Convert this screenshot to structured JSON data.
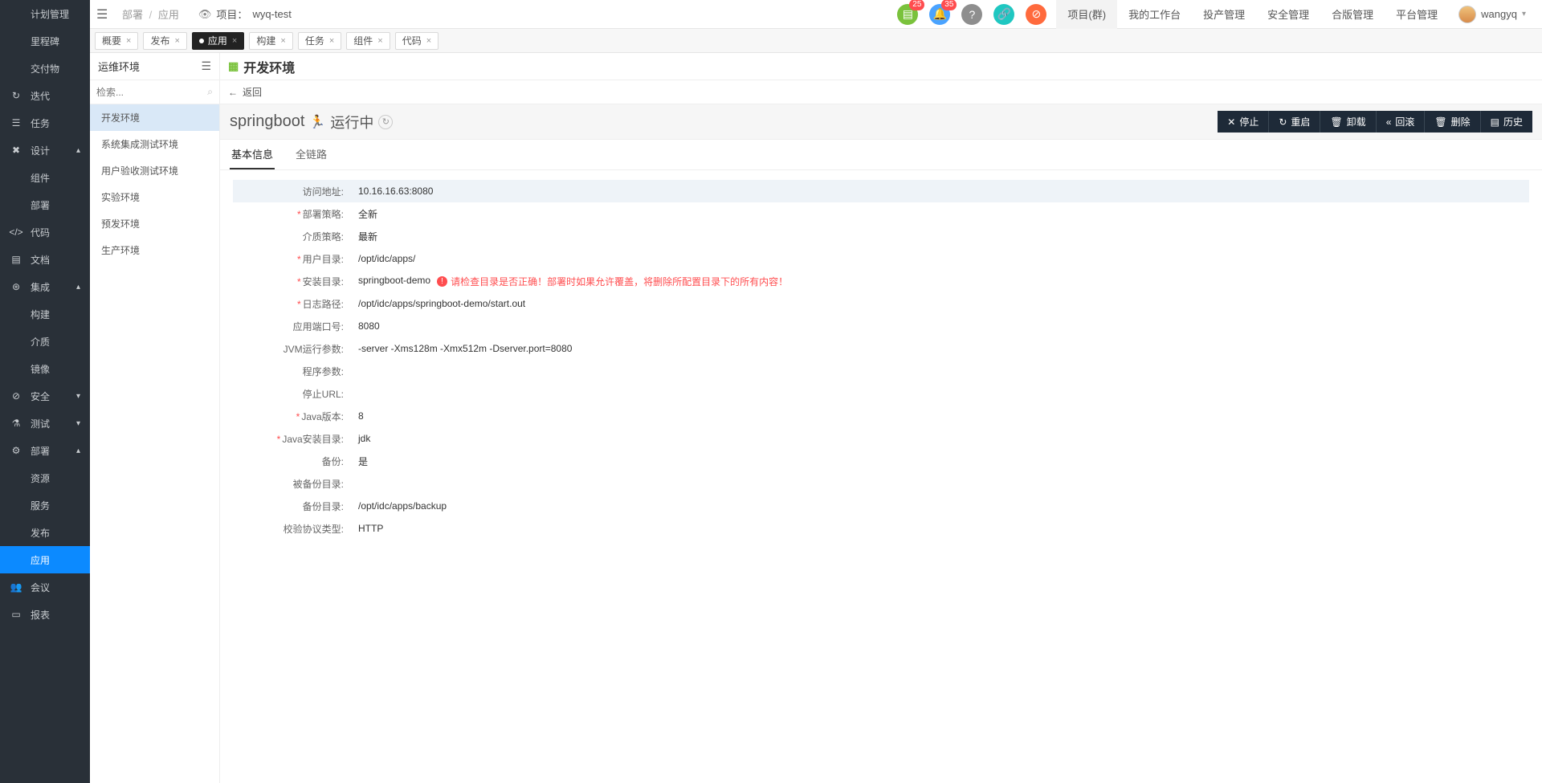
{
  "nav": {
    "items": [
      {
        "label": "计划管理",
        "icon": "",
        "sub": false,
        "head": true
      },
      {
        "label": "里程碑",
        "icon": "",
        "sub": true
      },
      {
        "label": "交付物",
        "icon": "",
        "sub": true
      },
      {
        "label": "迭代",
        "icon": "↻",
        "sub": false
      },
      {
        "label": "任务",
        "icon": "☰",
        "sub": false
      },
      {
        "label": "设计",
        "icon": "✖",
        "sub": false,
        "chev": "▴"
      },
      {
        "label": "组件",
        "icon": "",
        "sub": true
      },
      {
        "label": "部署",
        "icon": "",
        "sub": true
      },
      {
        "label": "代码",
        "icon": "</>",
        "sub": false
      },
      {
        "label": "文档",
        "icon": "▤",
        "sub": false
      },
      {
        "label": "集成",
        "icon": "⊛",
        "sub": false,
        "chev": "▴"
      },
      {
        "label": "构建",
        "icon": "",
        "sub": true
      },
      {
        "label": "介质",
        "icon": "",
        "sub": true
      },
      {
        "label": "镜像",
        "icon": "",
        "sub": true
      },
      {
        "label": "安全",
        "icon": "⊘",
        "sub": false,
        "chev": "▾"
      },
      {
        "label": "测试",
        "icon": "⚗",
        "sub": false,
        "chev": "▾"
      },
      {
        "label": "部署",
        "icon": "⚙",
        "sub": false,
        "chev": "▴"
      },
      {
        "label": "资源",
        "icon": "",
        "sub": true
      },
      {
        "label": "服务",
        "icon": "",
        "sub": true
      },
      {
        "label": "发布",
        "icon": "",
        "sub": true
      },
      {
        "label": "应用",
        "icon": "",
        "sub": true,
        "active": true
      },
      {
        "label": "会议",
        "icon": "👥",
        "sub": false
      },
      {
        "label": "报表",
        "icon": "▭",
        "sub": false
      }
    ]
  },
  "top": {
    "breadcrumb": {
      "a": "部署",
      "b": "应用"
    },
    "project_label": "项目：",
    "project_name": "wyq-test",
    "badges": {
      "b1": "25",
      "b2": "35"
    },
    "tabs": [
      "项目(群)",
      "我的工作台",
      "投产管理",
      "安全管理",
      "合版管理",
      "平台管理"
    ],
    "user": "wangyq"
  },
  "subtabs": [
    "概要",
    "发布",
    "应用",
    "构建",
    "任务",
    "组件",
    "代码"
  ],
  "subtab_active_index": 2,
  "side2": {
    "title": "运维环境",
    "search_placeholder": "检索...",
    "envs": [
      "开发环境",
      "系统集成测试环境",
      "用户验收测试环境",
      "实验环境",
      "预发环境",
      "生产环境"
    ],
    "active_index": 0
  },
  "main": {
    "title": "开发环境",
    "back": "返回",
    "app_name": "springboot",
    "run_state": "运行中",
    "buttons": [
      {
        "icon": "✕",
        "label": "停止"
      },
      {
        "icon": "↻",
        "label": "重启"
      },
      {
        "icon": "🗑",
        "label": "卸载"
      },
      {
        "icon": "«",
        "label": "回滚"
      },
      {
        "icon": "🗑",
        "label": "删除"
      },
      {
        "icon": "▤",
        "label": "历史"
      }
    ],
    "detail_tabs": [
      "基本信息",
      "全链路"
    ],
    "detail_active": 0,
    "rows": [
      {
        "label": "访问地址:",
        "value": "10.16.16.63:8080",
        "hl": true,
        "req": false
      },
      {
        "label": "部署策略:",
        "value": "全新",
        "req": true
      },
      {
        "label": "介质策略:",
        "value": "最新",
        "req": false
      },
      {
        "label": "用户目录:",
        "value": "/opt/idc/apps/",
        "req": true
      },
      {
        "label": "安装目录:",
        "value": "springboot-demo",
        "req": true,
        "warn": "请检查目录是否正确！部署时如果允许覆盖，将删除所配置目录下的所有内容！"
      },
      {
        "label": "日志路径:",
        "value": "/opt/idc/apps/springboot-demo/start.out",
        "req": true
      },
      {
        "label": "应用端口号:",
        "value": "8080",
        "req": false
      },
      {
        "label": "JVM运行参数:",
        "value": "-server -Xms128m -Xmx512m -Dserver.port=8080",
        "req": false
      },
      {
        "label": "程序参数:",
        "value": "",
        "req": false
      },
      {
        "label": "停止URL:",
        "value": "",
        "req": false
      },
      {
        "label": "Java版本:",
        "value": "8",
        "req": true
      },
      {
        "label": "Java安装目录:",
        "value": "jdk",
        "req": true
      },
      {
        "label": "备份:",
        "value": "是",
        "req": false
      },
      {
        "label": "被备份目录:",
        "value": "",
        "req": false
      },
      {
        "label": "备份目录:",
        "value": "/opt/idc/apps/backup",
        "req": false
      },
      {
        "label": "校验协议类型:",
        "value": "HTTP",
        "req": false
      }
    ]
  }
}
